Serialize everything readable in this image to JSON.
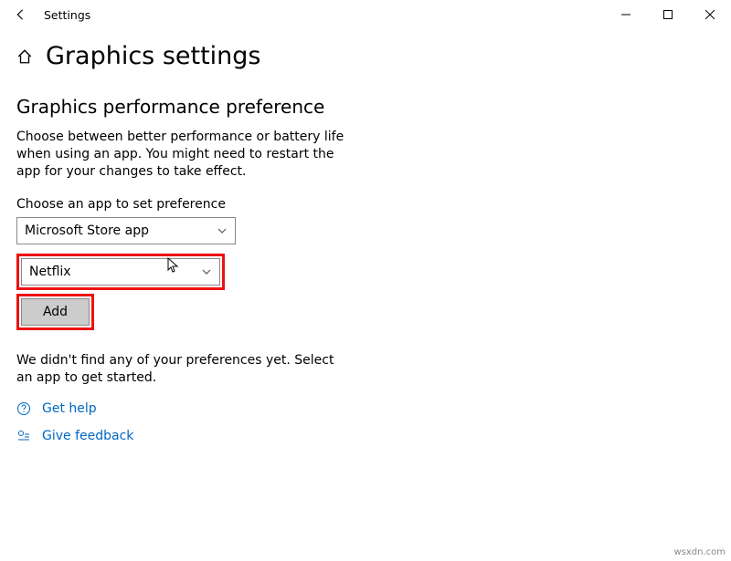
{
  "titlebar": {
    "title": "Settings"
  },
  "page": {
    "heading": "Graphics settings",
    "subheading": "Graphics performance preference",
    "description": "Choose between better performance or battery life when using an app. You might need to restart the app for your changes to take effect.",
    "choose_label": "Choose an app to set preference",
    "app_type_value": "Microsoft Store app",
    "app_selected": "Netflix",
    "add_label": "Add",
    "empty_msg": "We didn't find any of your preferences yet. Select an app to get started."
  },
  "links": {
    "help": "Get help",
    "feedback": "Give feedback"
  },
  "watermark": "wsxdn.com"
}
